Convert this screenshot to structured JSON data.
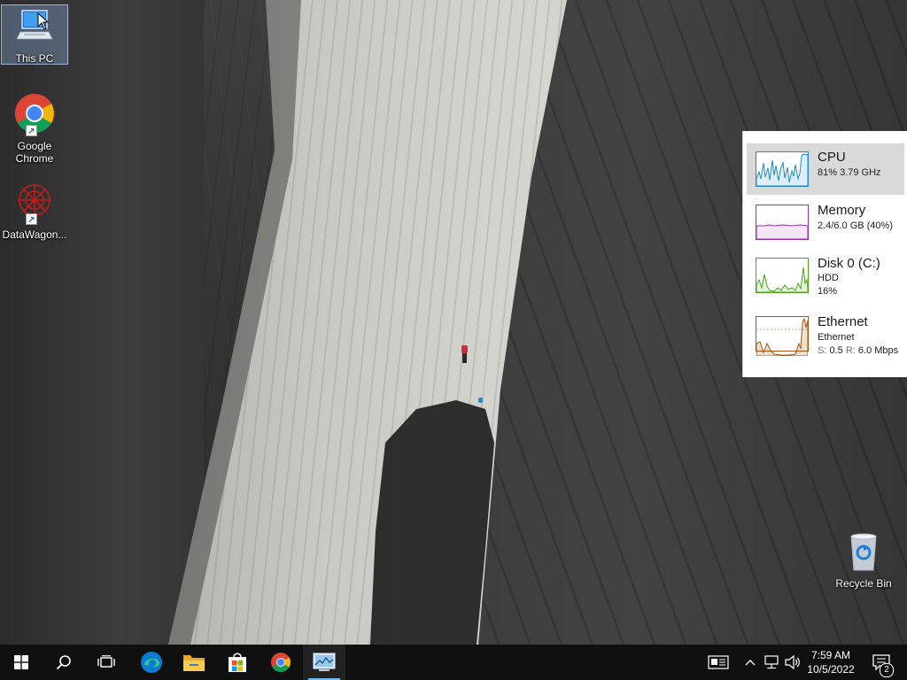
{
  "desktop": {
    "icons": [
      {
        "label": "This PC"
      },
      {
        "label": "Google Chrome"
      },
      {
        "label": "DataWagon..."
      },
      {
        "label": "Recycle Bin"
      }
    ]
  },
  "perf": {
    "cpu": {
      "title": "CPU",
      "line1": "81% 3.79 GHz",
      "color": "#1e8cc4"
    },
    "memory": {
      "title": "Memory",
      "line1": "2.4/6.0 GB (40%)",
      "color": "#9b2fae"
    },
    "disk": {
      "title": "Disk 0 (C:)",
      "line1": "HDD",
      "line2": "16%",
      "color": "#4ca318"
    },
    "ethernet": {
      "title": "Ethernet",
      "line1": "Ethernet",
      "line2_s": "S:",
      "line2_s_val": "0.5",
      "line2_r": "R:",
      "line2_r_val": "6.0 Mbps",
      "color": "#a9540f"
    }
  },
  "taskbar": {
    "clock_time": "7:59 AM",
    "clock_date": "10/5/2022",
    "notification_count": "2",
    "accent": "#76b9ed"
  }
}
